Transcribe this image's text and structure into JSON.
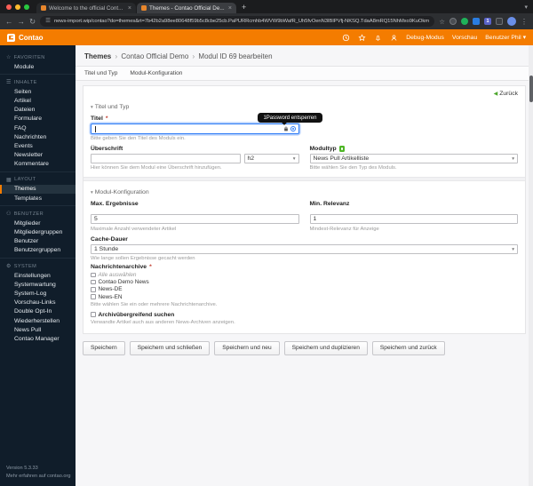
{
  "colors": {
    "accent": "#f47c00",
    "focus_ring": "#2f7cf6",
    "sidebar_bg": "#101d2a",
    "tooltip_bg": "#111111"
  },
  "icons": {
    "close": "×",
    "plus": "+",
    "caret": "▾",
    "back": "←",
    "forward": "→",
    "reload": "↻",
    "star": "☆",
    "kebab": "⋮",
    "tune": "☰",
    "breadcrumb_sep": "›",
    "back_triangle": "◀",
    "onepassword_badge": "1"
  },
  "browser": {
    "tabs": [
      {
        "title": "Welcome to the official Cont..."
      },
      {
        "title": "Themes - Contao Official De..."
      }
    ],
    "url": "news-import.wip/contao?do=themes&rt=7b42b2a98ee80648f59b5c8cbe25cb.PaPURRcmhb4WVW9bWafR_Uh5fvOenN3IBIPVfj-NKSQ.TdaA8mRQ15NhMxo9KuOkmQ..."
  },
  "header": {
    "brand": "Contao",
    "debug_label": "Debug-Modus",
    "preview_label": "Vorschau",
    "user_label": "Benutzer Phil"
  },
  "sidebar": {
    "groups": [
      {
        "label": "FAVORITEN",
        "icon": "☆",
        "items": [
          "Module"
        ]
      },
      {
        "label": "INHALTE",
        "icon": "☰",
        "items": [
          "Seiten",
          "Artikel",
          "Dateien",
          "Formulare",
          "FAQ",
          "Nachrichten",
          "Events",
          "Newsletter",
          "Kommentare"
        ]
      },
      {
        "label": "LAYOUT",
        "icon": "▦",
        "items": [
          "Themes",
          "Templates"
        ]
      },
      {
        "label": "BENUTZER",
        "icon": "⚇",
        "items": [
          "Mitglieder",
          "Mitgliedergruppen",
          "Benutzer",
          "Benutzergruppen"
        ]
      },
      {
        "label": "SYSTEM",
        "icon": "⚙",
        "items": [
          "Einstellungen",
          "Systemwartung",
          "System-Log",
          "Vorschau-Links",
          "Double Opt-In",
          "Wiederherstellen",
          "News Pull",
          "Contao Manager"
        ]
      }
    ],
    "version": "Version 5.3.33",
    "more_link": "Mehr erfahren auf contao.org"
  },
  "main": {
    "breadcrumb": {
      "parts": [
        "Themes",
        "Contao Official Demo",
        "Modul ID 69 bearbeiten"
      ]
    },
    "section_links": [
      "Titel und Typ",
      "Modul-Konfiguration"
    ],
    "back_label": "Zurück",
    "form": {
      "section1": {
        "title": "Titel und Typ",
        "titel": {
          "label": "Titel",
          "mandatory": "*",
          "value": "",
          "helper": "Bitte geben Sie den Titel des Moduls ein.",
          "tooltip": "1Password entsperren"
        },
        "ueberschrift": {
          "label": "Überschrift",
          "value": "",
          "unit_value": "h2",
          "helper": "Hier können Sie dem Modul eine Überschrift hinzufügen."
        },
        "modultyp": {
          "label": "Modultyp",
          "value": "News Pull Artikelliste",
          "helper": "Bitte wählen Sie den Typ des Moduls."
        }
      },
      "section2": {
        "title": "Modul-Konfiguration",
        "max": {
          "label": "Max. Ergebnisse",
          "value": "5",
          "helper": "Maximale Anzahl verwendeter Artikel"
        },
        "min": {
          "label": "Min. Relevanz",
          "value": "1",
          "helper": "Mindest-Relevanz für Anzeige"
        },
        "cache": {
          "label": "Cache-Dauer",
          "value": "1 Stunde",
          "helper": "Wie lange sollen Ergebnisse gecacht werden"
        },
        "archive": {
          "label": "Nachrichtenarchive",
          "mandatory": "*",
          "options": [
            "Alle auswählen",
            "Contao Demo News",
            "News-DE",
            "News-EN"
          ],
          "helper": "Bitte wählen Sie ein oder mehrere Nachrichtenarchive."
        },
        "cross": {
          "label": "Archivübergreifend suchen",
          "helper": "Verwandte Artikel auch aus anderen News-Archiven anzeigen."
        }
      },
      "buttons": [
        "Speichern",
        "Speichern und schließen",
        "Speichern und neu",
        "Speichern und duplizieren",
        "Speichern und zurück"
      ]
    }
  }
}
